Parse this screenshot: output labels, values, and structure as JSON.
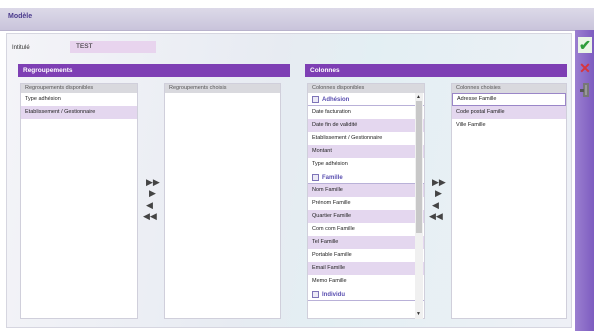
{
  "window": {
    "title": "Modèle"
  },
  "form": {
    "intitule_label": "Intitulé",
    "intitule_value": "TEST"
  },
  "regroupements": {
    "header": "Regroupements",
    "available_header": "Regroupements disponibles",
    "chosen_header": "Regroupements choisis",
    "available": [
      "Type adhésion",
      "Etablissement / Gestionnaire"
    ],
    "chosen": []
  },
  "colonnes": {
    "header": "Colonnes",
    "available_header": "Colonnes disponibles",
    "chosen_header": "Colonnes choisies",
    "groups": [
      {
        "name": "Adhésion",
        "items": [
          "Date facturation",
          "Date fin de validité",
          "Etablissement / Gestionnaire",
          "Montant",
          "Type adhésion"
        ]
      },
      {
        "name": "Famille",
        "items": [
          "Nom Famille",
          "Prénom Famille",
          "Quartier Famille",
          "Com com Famille",
          "Tel Famille",
          "Portable Famille",
          "Email Famille",
          "Memo Famille"
        ]
      },
      {
        "name": "Individu",
        "items": []
      }
    ],
    "chosen": [
      "Adresse Famille",
      "Code postal Famille",
      "Ville Famille"
    ]
  },
  "icons": {
    "move_all_right": "double-arrow-right-icon",
    "move_right": "arrow-right-icon",
    "move_left": "arrow-left-icon",
    "move_all_left": "double-arrow-left-icon",
    "validate": "checkmark-icon",
    "cancel": "x-icon",
    "exit": "exit-door-icon"
  },
  "colors": {
    "accent": "#7e3fb4",
    "shaded_row": "#e4d7ef",
    "validate": "#2e9e3a",
    "cancel": "#d9343b"
  }
}
